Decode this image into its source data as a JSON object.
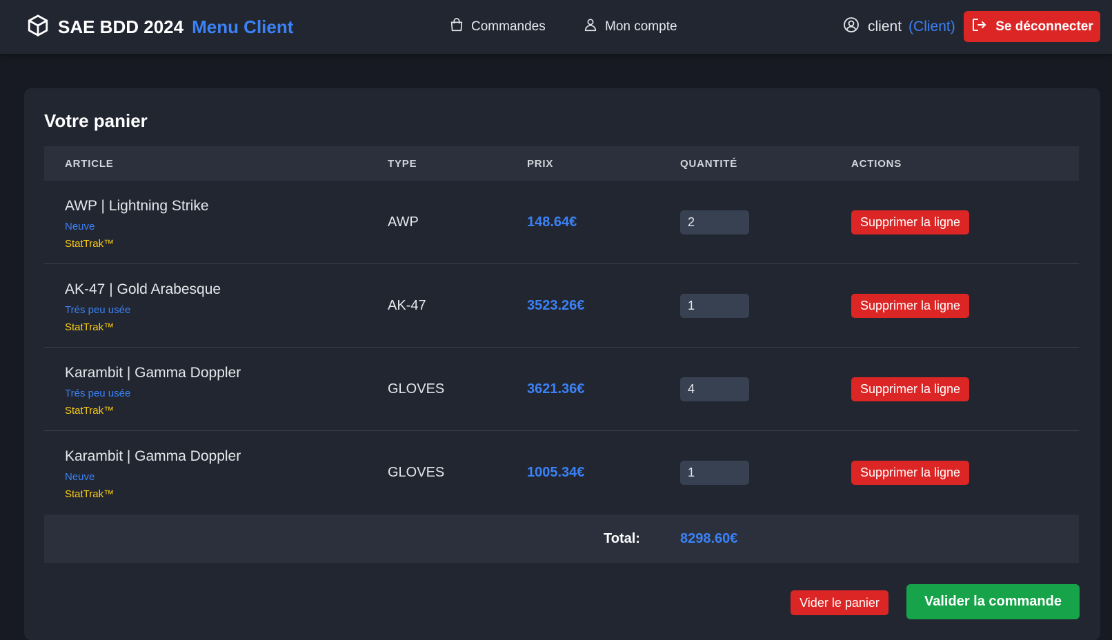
{
  "header": {
    "brand_title": "SAE BDD 2024",
    "brand_subtitle": "Menu Client",
    "nav": [
      {
        "label": "Commandes",
        "icon": "shopping-bag-icon"
      },
      {
        "label": "Mon compte",
        "icon": "user-icon"
      }
    ],
    "user": {
      "name": "client",
      "role": "(Client)",
      "icon": "user-circle-icon"
    },
    "logout_label": "Se déconnecter"
  },
  "cart": {
    "title": "Votre panier",
    "columns": [
      "ARTICLE",
      "TYPE",
      "PRIX",
      "QUANTITÉ",
      "ACTIONS"
    ],
    "rows": [
      {
        "name": "AWP | Lightning Strike",
        "wear": "Neuve",
        "stattrak": "StatTrak™",
        "type": "AWP",
        "price": "148.64€",
        "quantity": "2",
        "action": "Supprimer la ligne"
      },
      {
        "name": "AK-47 | Gold Arabesque",
        "wear": "Trés peu usée",
        "stattrak": "StatTrak™",
        "type": "AK-47",
        "price": "3523.26€",
        "quantity": "1",
        "action": "Supprimer la ligne"
      },
      {
        "name": "Karambit | Gamma Doppler",
        "wear": "Trés peu usée",
        "stattrak": "StatTrak™",
        "type": "GLOVES",
        "price": "3621.36€",
        "quantity": "4",
        "action": "Supprimer la ligne"
      },
      {
        "name": "Karambit | Gamma Doppler",
        "wear": "Neuve",
        "stattrak": "StatTrak™",
        "type": "GLOVES",
        "price": "1005.34€",
        "quantity": "1",
        "action": "Supprimer la ligne"
      }
    ],
    "total_label": "Total:",
    "total_value": "8298.60€",
    "clear_label": "Vider le panier",
    "validate_label": "Valider la commande"
  },
  "colors": {
    "accent": "#3b82f6",
    "danger": "#dc2626",
    "success": "#16a34a",
    "stattrak": "#facc15",
    "background": "#171a22",
    "surface": "#222631"
  }
}
